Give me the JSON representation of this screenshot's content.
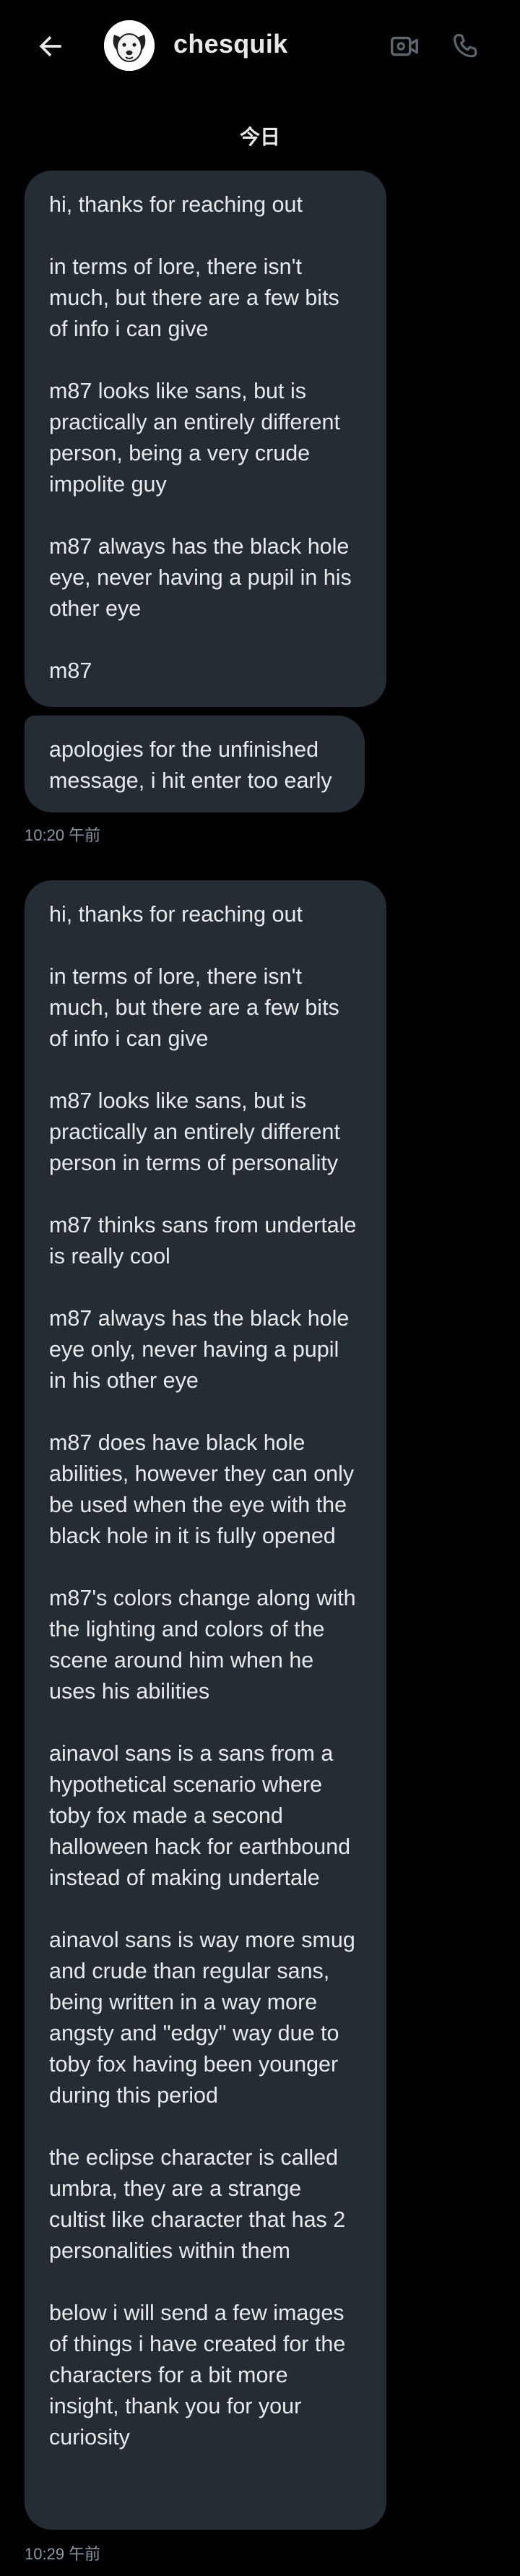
{
  "header": {
    "contact_name": "chesquik",
    "back_icon": "arrow-left-icon",
    "video_icon": "video-camera-icon",
    "call_icon": "phone-icon",
    "avatar_icon": "dog-avatar"
  },
  "date_separator": "今日",
  "messages": [
    {
      "paragraphs": [
        "hi, thanks for reaching out",
        "in terms of lore, there isn't much, but there are a few bits of info i can give",
        "m87 looks like sans, but is practically an entirely different person, being a very crude impolite guy",
        "m87 always has the black hole eye, never having a pupil in his other eye",
        "m87"
      ]
    },
    {
      "paragraphs": [
        "apologies for the unfinished message, i hit enter too early"
      ],
      "time": "10:20 午前"
    },
    {
      "paragraphs": [
        "hi, thanks for reaching out",
        "in terms of lore, there isn't much, but there are a few bits of info i can give",
        "m87 looks like sans, but is practically an entirely different person in terms of personality",
        "m87 thinks sans from undertale is really cool",
        "m87 always has the black hole eye only, never having a pupil in his other eye",
        "m87 does have black hole abilities, however they can only be used when the eye with the black hole in it is fully opened",
        "m87's colors change along with the lighting and colors of the scene around him when he uses his abilities",
        "ainavol sans is a sans from a hypothetical scenario where toby fox made a second halloween hack for earthbound instead of making undertale",
        "ainavol sans is way more smug and crude than regular sans, being written in a way more angsty and \"edgy\" way due to toby fox having been younger during this period",
        "the eclipse character is called umbra, they are a strange cultist like character that has 2 personalities within them",
        "below i will send a few images of things i have created for the characters for a bit more insight, thank you for your curiosity"
      ],
      "time": "10:29 午前"
    }
  ],
  "colors": {
    "background": "#000000",
    "bubble": "#252d34",
    "text": "#e7e9ea",
    "timestamp": "#8b98a5"
  }
}
